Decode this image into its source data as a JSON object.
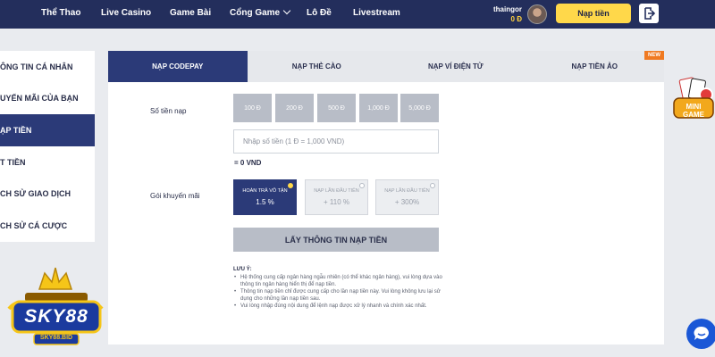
{
  "nav": {
    "items": [
      "Thể Thao",
      "Live Casino",
      "Game Bài",
      "Cổng Game",
      "Lô Đề",
      "Livestream"
    ],
    "username": "thaingor",
    "balance": "0 Đ",
    "deposit_label": "Nạp tiền"
  },
  "sidebar": {
    "items": [
      "ÔNG TIN CÁ NHÂN",
      "UYẾN MÃI CỦA BẠN",
      "ẠP TIỀN",
      "T TIỀN",
      "CH SỬ GIAO DỊCH",
      "CH SỬ CÁ CƯỢC"
    ],
    "active_index": 2
  },
  "tabs": {
    "items": [
      "NẠP CODEPAY",
      "NẠP THẺ CÀO",
      "NẠP VÍ ĐIỆN TỬ",
      "NẠP TIỀN ẢO"
    ],
    "active_index": 0,
    "new_badge": "NEW"
  },
  "form": {
    "amount_label": "Số tiền nạp",
    "amount_options": [
      "100 Đ",
      "200 Đ",
      "500 Đ",
      "1,000 Đ",
      "5,000 Đ"
    ],
    "amount_placeholder": "Nhập số tiền (1 Đ = 1,000 VND)",
    "total": "= 0 VND",
    "promo_label": "Gói khuyến mãi",
    "promos": [
      {
        "title": "HOÀN TRẢ VÔ TẬN",
        "value": "1.5 %",
        "selected": true
      },
      {
        "title": "NẠP LẦN ĐẦU TIÊN",
        "value": "+ 110 %",
        "selected": false
      },
      {
        "title": "NẠP LẦN ĐẦU TIÊN",
        "value": "+ 300%",
        "selected": false
      }
    ],
    "submit_label": "LẤY THÔNG TIN NẠP TIỀN"
  },
  "notes": {
    "title": "LƯU Ý:",
    "items": [
      "Hệ thống cung cấp ngân hàng ngẫu nhiên (có thể khác ngân hàng), vui lòng dựa vào thông tin ngân hàng hiển thị để nạp tiền.",
      "Thông tin nạp tiền chỉ được cung cấp cho lần nạp tiền này. Vui lòng không lưu lại sử dụng cho những lần nạp tiền sau.",
      "Vui lòng nhập đúng nội dung để lệnh nạp được xử lý nhanh và chính xác nhất."
    ]
  },
  "brand": {
    "logo_text": "SKY88",
    "logo_sub": "SKY88.BID",
    "minigame_text": "MINI GAME"
  },
  "colors": {
    "nav_bg": "#232e5c",
    "accent_navy": "#2b3a78",
    "accent_yellow": "#ffd84a",
    "badge_orange": "#f07a22",
    "chat_blue": "#1a57d6"
  },
  "icons": {
    "logout": "logout-icon",
    "dropdown": "chevron-down-icon",
    "chat": "chat-icon"
  }
}
